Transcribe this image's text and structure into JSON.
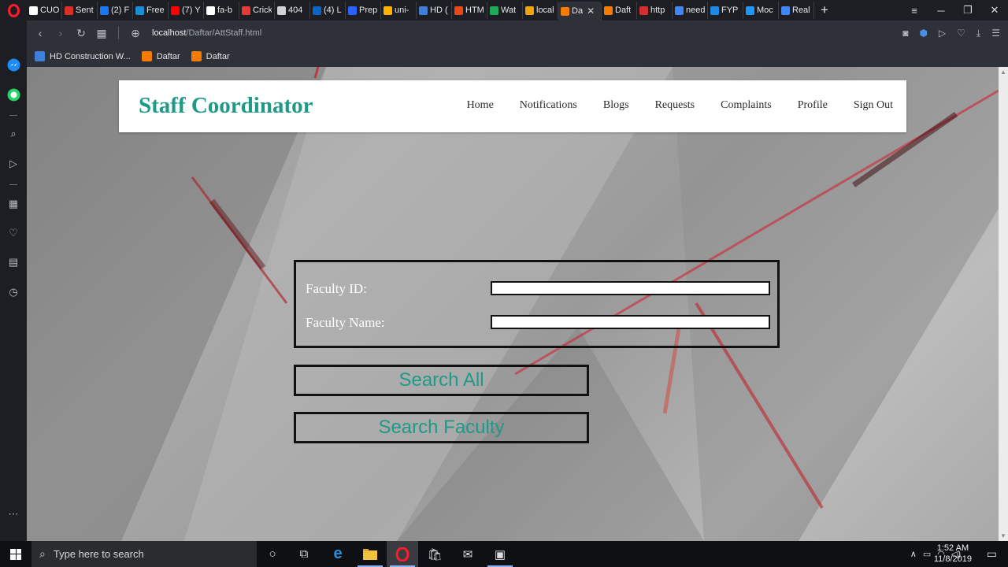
{
  "browser": {
    "tabs": [
      {
        "title": "CUO",
        "color": "#ffffff",
        "active": false
      },
      {
        "title": "Sent",
        "color": "#d93025",
        "active": false
      },
      {
        "title": "(2) F",
        "color": "#1877f2",
        "active": false
      },
      {
        "title": "Free",
        "color": "#1a8fd6",
        "active": false
      },
      {
        "title": "(7) Y",
        "color": "#ff0000",
        "active": false
      },
      {
        "title": "fa-b",
        "color": "#ffffff",
        "active": false
      },
      {
        "title": "Crick",
        "color": "#e53935",
        "active": false
      },
      {
        "title": "404",
        "color": "#cfd2d6",
        "active": false
      },
      {
        "title": "(4) L",
        "color": "#0a66c2",
        "active": false
      },
      {
        "title": "Prep",
        "color": "#2962ff",
        "active": false
      },
      {
        "title": "uni-",
        "color": "#ffb300",
        "active": false
      },
      {
        "title": "HD (",
        "color": "#3f7fd8",
        "active": false
      },
      {
        "title": "HTM",
        "color": "#e8471c",
        "active": false
      },
      {
        "title": "Wat",
        "color": "#1faa59",
        "active": false
      },
      {
        "title": "local",
        "color": "#f0a30a",
        "active": false
      },
      {
        "title": "Da",
        "color": "#f57c00",
        "active": true
      },
      {
        "title": "Daft",
        "color": "#f57c00",
        "active": false
      },
      {
        "title": "http",
        "color": "#d32f2f",
        "active": false
      },
      {
        "title": "need",
        "color": "#4285f4",
        "active": false
      },
      {
        "title": "FYP",
        "color": "#1e88e5",
        "active": false
      },
      {
        "title": "Moc",
        "color": "#2196f3",
        "active": false
      },
      {
        "title": "Real",
        "color": "#4285f4",
        "active": false
      }
    ],
    "url_host": "localhost",
    "url_path": "/Daftar/AttStaff.html",
    "bookmarks": [
      {
        "label": "HD Construction W...",
        "color": "#3f7fd8"
      },
      {
        "label": "Daftar",
        "color": "#f57c00"
      },
      {
        "label": "Daftar",
        "color": "#f57c00"
      }
    ]
  },
  "page": {
    "brand": "Staff Coordinator",
    "nav": [
      "Home",
      "Notifications",
      "Blogs",
      "Requests",
      "Complaints",
      "Profile",
      "Sign Out"
    ],
    "form": {
      "faculty_id_label": "Faculty ID:",
      "faculty_id_value": "",
      "faculty_name_label": "Faculty Name:",
      "faculty_name_value": ""
    },
    "buttons": {
      "search_all": "Search All",
      "search_faculty": "Search Faculty"
    },
    "accent_color": "#1e9a86"
  },
  "taskbar": {
    "search_placeholder": "Type here to search",
    "time": "1:52 AM",
    "date": "11/8/2019"
  }
}
